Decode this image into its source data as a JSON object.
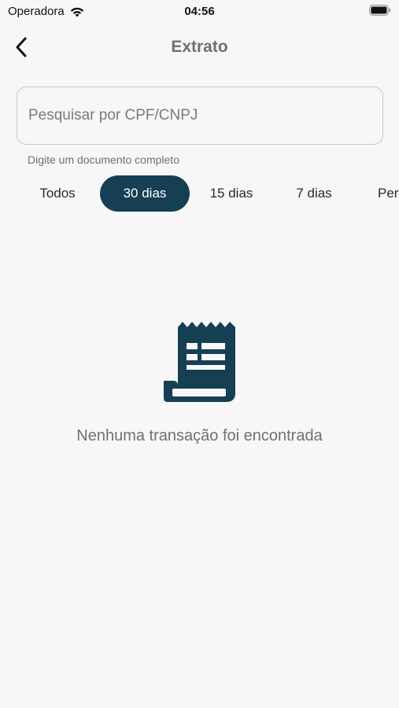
{
  "status_bar": {
    "carrier": "Operadora",
    "time": "04:56"
  },
  "header": {
    "title": "Extrato"
  },
  "search": {
    "placeholder": "Pesquisar por CPF/CNPJ",
    "value": "",
    "hint": "Digite um documento completo"
  },
  "filters": {
    "items": [
      {
        "label": "Todos",
        "selected": false
      },
      {
        "label": "30 dias",
        "selected": true
      },
      {
        "label": "15 dias",
        "selected": false
      },
      {
        "label": "7 dias",
        "selected": false
      },
      {
        "label": "Pers",
        "selected": false
      }
    ]
  },
  "empty_state": {
    "icon": "receipt-icon",
    "message": "Nenhuma transação foi encontrada"
  },
  "colors": {
    "accent": "#173f54",
    "background": "#f7f7f7",
    "title": "#707070"
  }
}
